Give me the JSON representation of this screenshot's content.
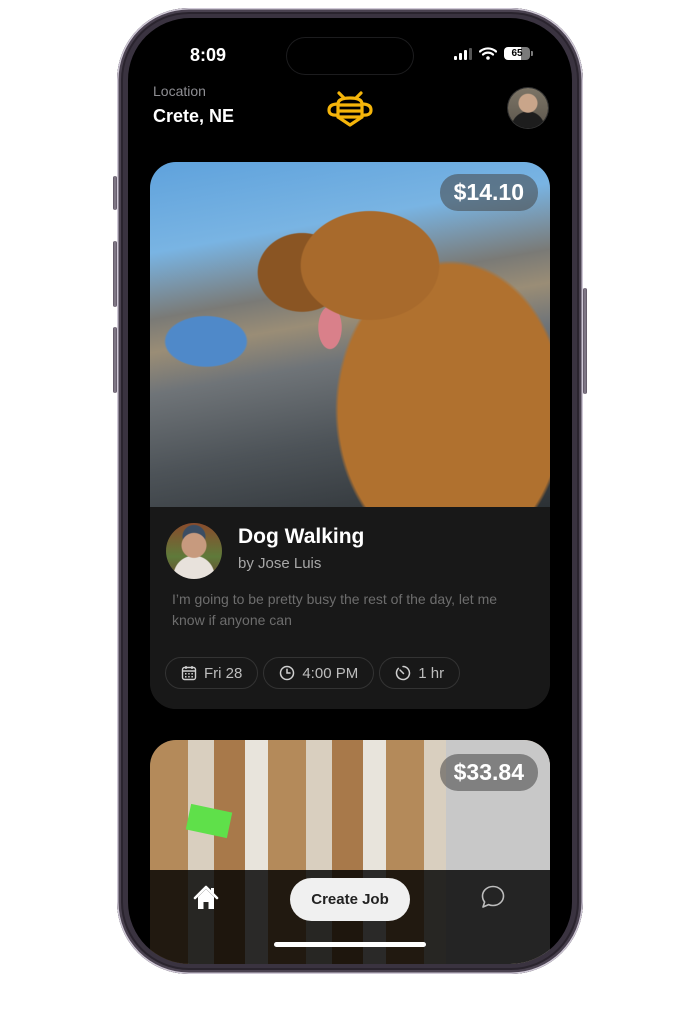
{
  "status_bar": {
    "time": "8:09",
    "battery": "65",
    "signal_icon": "cellular-signal-icon",
    "wifi_icon": "wifi-icon"
  },
  "header": {
    "location_label": "Location",
    "location_value": "Crete, NE",
    "logo_icon": "bee-logo-icon",
    "profile_icon": "profile-avatar"
  },
  "colors": {
    "brand": "#F5B50A",
    "background": "#000000",
    "card": "#181818"
  },
  "jobs": [
    {
      "price": "$14.10",
      "image": "dog-in-car-photo",
      "title": "Dog Walking",
      "by": "by Jose Luis",
      "description": "I’m going to be pretty busy the rest of the day, let me know if anyone can",
      "chips": [
        {
          "icon": "calendar-icon",
          "label": "Fri 28"
        },
        {
          "icon": "clock-icon",
          "label": "4:00 PM"
        },
        {
          "icon": "timer-icon",
          "label": "1 hr"
        }
      ]
    },
    {
      "price": "$33.84",
      "image": "warehouse-boxes-photo"
    }
  ],
  "tab_bar": {
    "home_icon": "home-icon",
    "create_label": "Create Job",
    "chat_icon": "chat-bubble-icon"
  }
}
